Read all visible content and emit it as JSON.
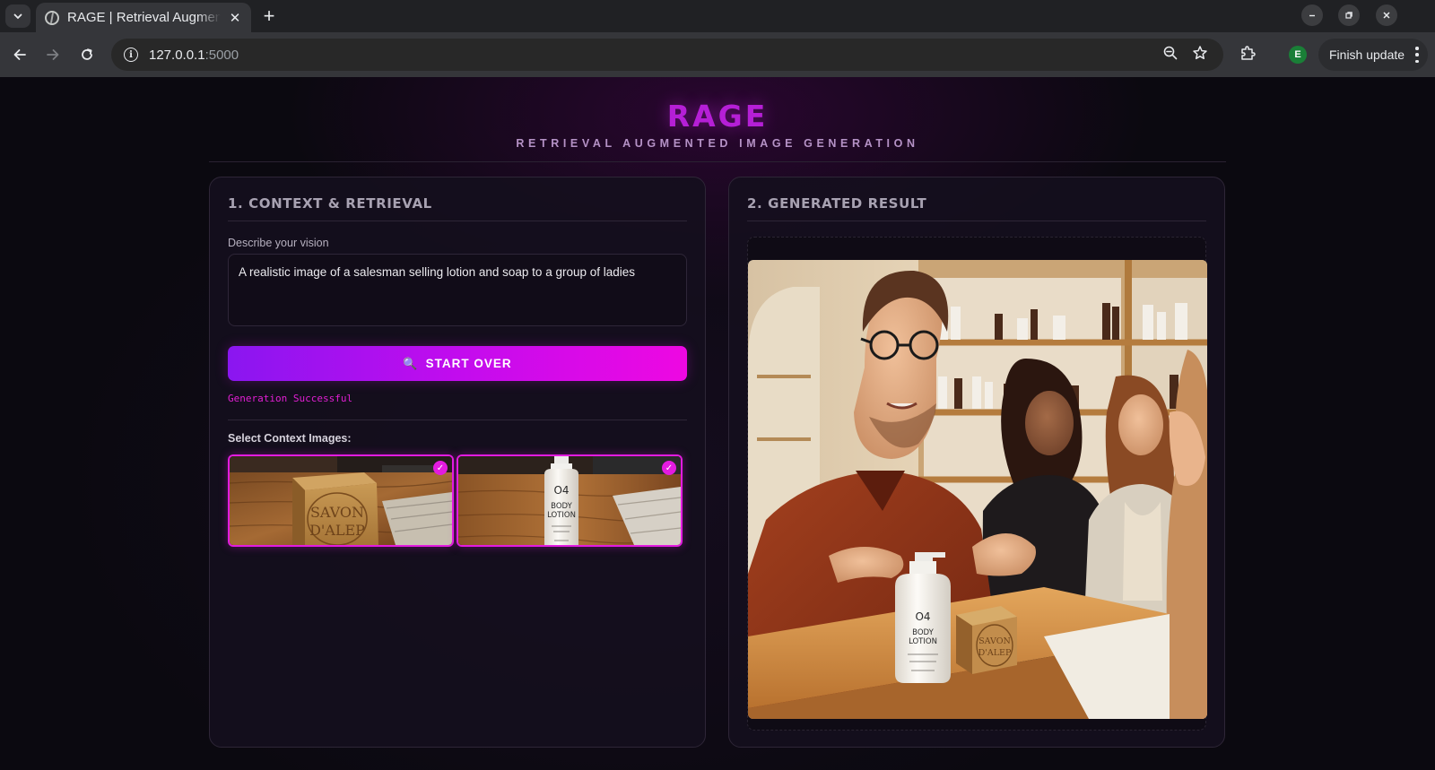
{
  "browser": {
    "tab_title": "RAGE | Retrieval Augmented Image Generation",
    "url_host": "127.0.0.1",
    "url_port": ":5000",
    "profile_initial": "E",
    "finish_update_label": "Finish update",
    "new_tab_symbol": "+",
    "tab_close_symbol": "✕"
  },
  "header": {
    "title": "RAGE",
    "subtitle": "RETRIEVAL AUGMENTED IMAGE GENERATION"
  },
  "context_panel": {
    "title": "1. CONTEXT & RETRIEVAL",
    "prompt_label": "Describe your vision",
    "prompt_value": "A realistic image of a salesman selling lotion and soap to a group of ladies",
    "button_label": "START OVER",
    "button_icon": "🔍",
    "status_text": "Generation Successful",
    "select_label": "Select Context Images:",
    "context_images": [
      {
        "name": "soap",
        "lines": [
          "SAVON",
          "D'ALEP"
        ],
        "selected": true
      },
      {
        "name": "lotion",
        "lines": [
          "O4",
          "BODY",
          "LOTION"
        ],
        "selected": true
      }
    ],
    "check_symbol": "✓"
  },
  "result_panel": {
    "title": "2. GENERATED RESULT",
    "bottle_lines": [
      "O4",
      "BODY",
      "LOTION"
    ],
    "soap_lines": [
      "SAVON",
      "D'ALEP"
    ]
  },
  "colors": {
    "accent": "#e31be0",
    "brand": "#b51fd6",
    "button_start": "#8a16f0",
    "button_end": "#ee08e2"
  },
  "icons": {
    "tab_list": "chevron-down-icon",
    "favicon": "globe-icon",
    "back": "arrow-left-icon",
    "forward": "arrow-right-icon",
    "reload": "reload-icon",
    "site_info": "info-icon",
    "zoom": "zoom-icon",
    "bookmark": "star-icon",
    "extensions": "puzzle-icon",
    "menu": "kebab-icon"
  }
}
